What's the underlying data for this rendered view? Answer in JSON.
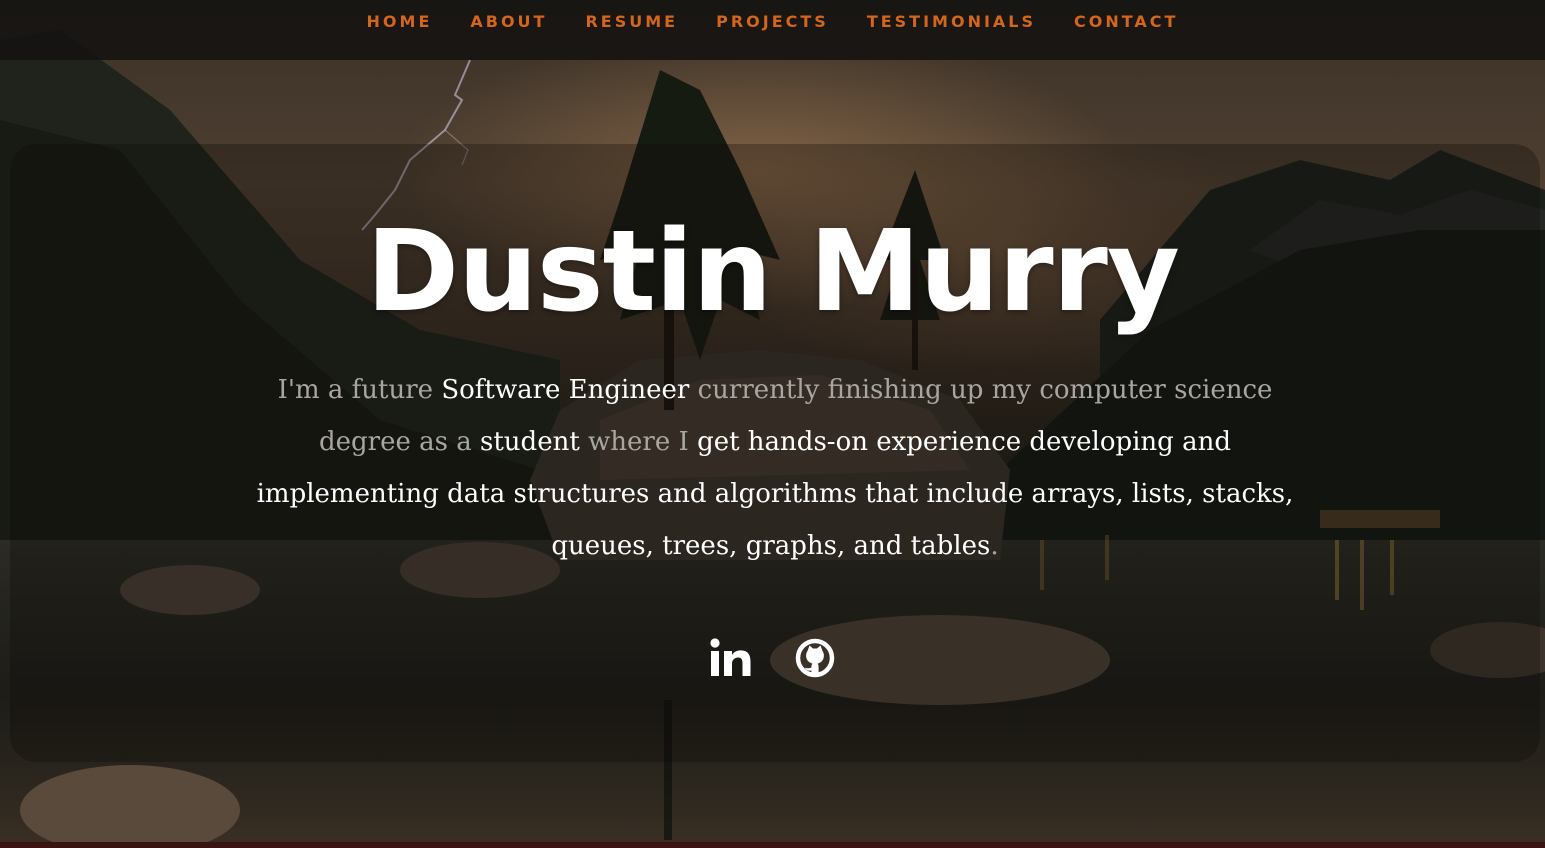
{
  "nav": {
    "items": [
      {
        "label": "HOME"
      },
      {
        "label": "ABOUT"
      },
      {
        "label": "RESUME"
      },
      {
        "label": "PROJECTS"
      },
      {
        "label": "TESTIMONIALS"
      },
      {
        "label": "CONTACT"
      }
    ]
  },
  "hero": {
    "name": "Dustin Murry",
    "bio": [
      {
        "text": "I'm a future ",
        "emphasis": false
      },
      {
        "text": "Software Engineer",
        "emphasis": true
      },
      {
        "text": " currently finishing up my computer science degree as a ",
        "emphasis": false
      },
      {
        "text": "student",
        "emphasis": true
      },
      {
        "text": " where I ",
        "emphasis": false
      },
      {
        "text": "get hands-on experience developing and implementing data structures and algorithms that include arrays, lists, stacks, queues, trees, graphs, and tables",
        "emphasis": true
      },
      {
        "text": ".",
        "emphasis": false
      }
    ]
  },
  "social": {
    "items": [
      {
        "icon": "linkedin-icon"
      },
      {
        "icon": "github-icon"
      }
    ]
  },
  "colors": {
    "nav_accent": "#d4661c",
    "nav_background": "#161311",
    "bio_muted": "#a9a6a1",
    "bio_emphasis": "#ffffff"
  }
}
